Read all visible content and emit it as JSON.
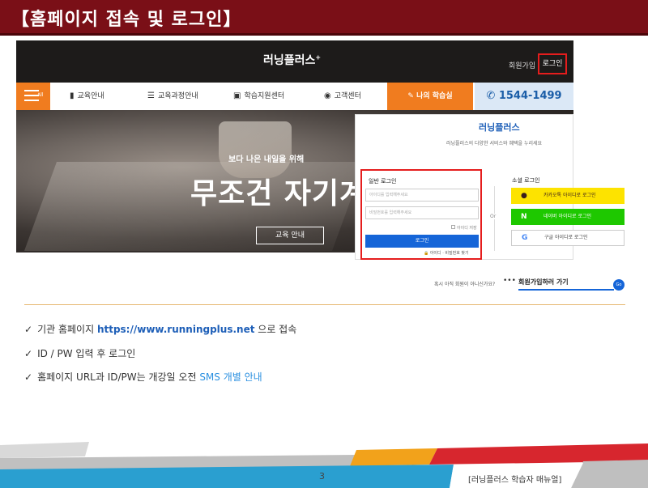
{
  "slide": {
    "title": "【홈페이지 접속 및 로그인】",
    "page_number": "3",
    "footer_label": "[러닝플러스 학습자 매뉴얼]"
  },
  "site": {
    "logo": "러닝플러스",
    "logo_plus": "+",
    "join": "회원가입",
    "login": "로그인",
    "nav": {
      "all": "All",
      "items": [
        "교육안내",
        "교육과정안내",
        "학습지원센터",
        "고객센터"
      ],
      "my_learning": "나의 학습실",
      "phone": "1544-1499"
    },
    "hero": {
      "subtitle": "보다 나은 내일을 위해",
      "headline": "무조건 자기계",
      "button": "교육 안내"
    }
  },
  "login_panel": {
    "logo": "러닝플러스",
    "description": "러닝플러스의 다양한 서비스와 혜택을 누리세요",
    "normal_title": "일반 로그인",
    "id_placeholder": "아이디를 입력해주세요",
    "pw_placeholder": "비밀번호를 입력해주세요",
    "keep_label": "아이디 저장",
    "login_button": "로그인",
    "find_link": "아이디 · 비밀번호 찾기",
    "or": "Or",
    "social_title": "소셜 로그인",
    "kakao": "카카오톡 아이디로 로그인",
    "naver": "네이버 아이디로 로그인",
    "google": "구글 아이디로 로그인"
  },
  "join_row": {
    "question": "혹시 아직 회원이 아니신가요?",
    "dots": "•••",
    "text": "회원가입하러 가기",
    "go": "Go"
  },
  "bullets": {
    "b1_prefix": "기관 홈페이지 ",
    "b1_url": "https://www.runningplus.net",
    "b1_suffix": " 으로 접속",
    "b2": "ID / PW 입력 후 로그인",
    "b3_prefix": "홈페이지 URL과 ID/PW는 개강일 오전 ",
    "b3_sms": "SMS 개별 안내"
  },
  "colors": {
    "title_bar": "#7a0f17",
    "accent_orange": "#f07c1f",
    "brand_blue": "#1565d8",
    "highlight_red": "#e51d1d",
    "kakao_yellow": "#fde300",
    "naver_green": "#1ec800"
  },
  "icons": {
    "check": "✓",
    "nav_all": "hamburger-icon",
    "nav_edu": "book-icon",
    "nav_course": "list-icon",
    "nav_support": "monitor-icon",
    "nav_cs": "headset-icon",
    "my_learning": "pencil-icon",
    "phone": "phone-icon"
  }
}
